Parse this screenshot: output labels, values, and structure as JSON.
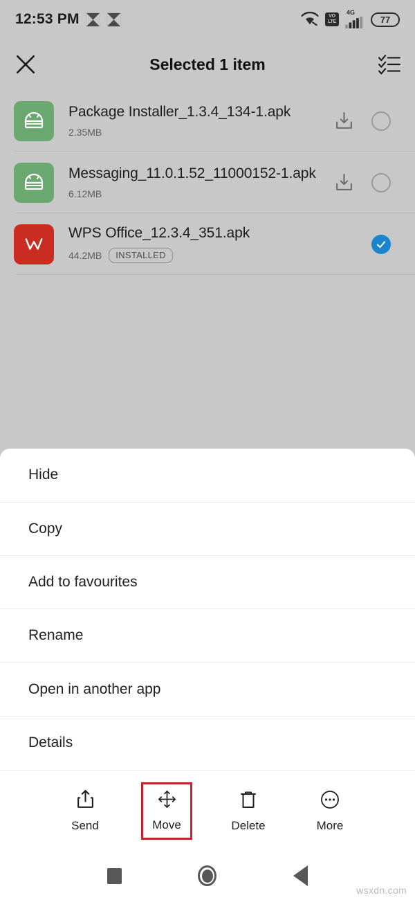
{
  "status_bar": {
    "time": "12:53 PM",
    "left_icons": [
      "app-glyph-icon",
      "app-glyph-icon"
    ],
    "wifi_icon": "wifi-icon",
    "volte_top": "VO",
    "volte_bottom": "LTE",
    "network_type": "4G",
    "signal_icon": "signal-bars-icon",
    "battery_level": "77"
  },
  "app_bar": {
    "close_icon": "close-icon",
    "title": "Selected 1 item",
    "select_all_icon": "select-all-checklist-icon"
  },
  "files": [
    {
      "name": "Package Installer_1.3.4_134-1.apk",
      "size": "2.35MB",
      "badge": "",
      "icon": "apk-android-icon",
      "icon_color": "#6aa870",
      "download_icon": "download-icon",
      "selected": false
    },
    {
      "name": "Messaging_11.0.1.52_11000152-1.apk",
      "size": "6.12MB",
      "badge": "",
      "icon": "apk-android-icon",
      "icon_color": "#6aa870",
      "download_icon": "download-icon",
      "selected": false
    },
    {
      "name": "WPS Office_12.3.4_351.apk",
      "size": "44.2MB",
      "badge": "INSTALLED",
      "icon": "wps-office-icon",
      "icon_color": "#ca2c22",
      "download_icon": "",
      "selected": true
    }
  ],
  "menu": {
    "items": [
      {
        "label": "Hide"
      },
      {
        "label": "Copy"
      },
      {
        "label": "Add to favourites"
      },
      {
        "label": "Rename"
      },
      {
        "label": "Open in another app"
      },
      {
        "label": "Details"
      }
    ]
  },
  "action_bar": {
    "highlight_color": "#bf2430",
    "actions": [
      {
        "label": "Send",
        "icon": "share-upload-icon",
        "highlighted": false
      },
      {
        "label": "Move",
        "icon": "move-arrows-icon",
        "highlighted": true
      },
      {
        "label": "Delete",
        "icon": "trash-icon",
        "highlighted": false
      },
      {
        "label": "More",
        "icon": "more-dots-circle-icon",
        "highlighted": false
      }
    ]
  },
  "nav_bar": {
    "recents_icon": "recents-square-icon",
    "home_icon": "home-circle-icon",
    "back_icon": "back-triangle-icon"
  },
  "watermark": "wsxdn.com",
  "colors": {
    "background": "#c8c8c8",
    "sheet": "#ffffff",
    "selected_check": "#1a84cc",
    "highlight": "#bf2430"
  }
}
